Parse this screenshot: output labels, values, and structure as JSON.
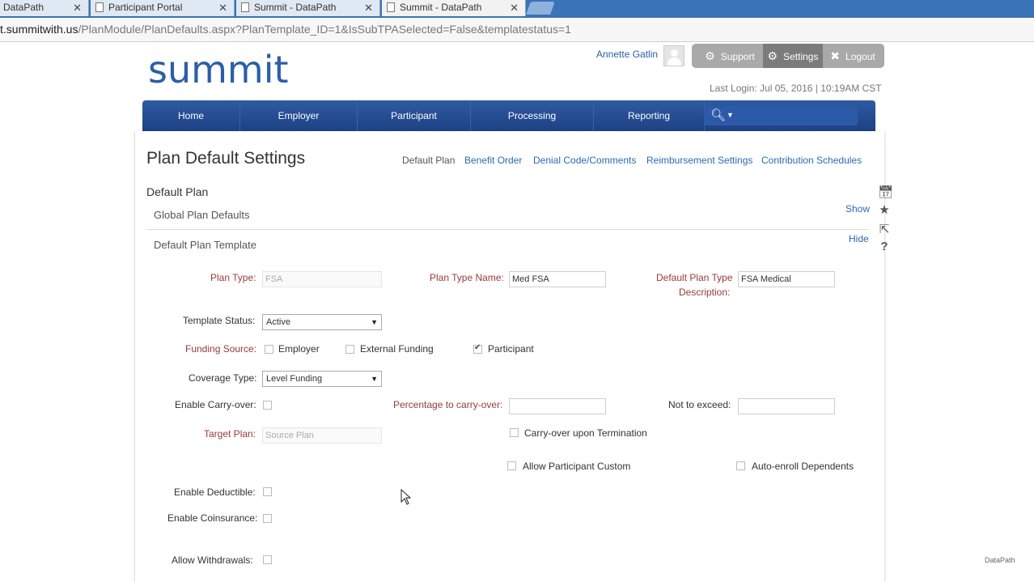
{
  "browser": {
    "tabs": [
      {
        "title": "DataPath"
      },
      {
        "title": "Participant Portal"
      },
      {
        "title": "Summit - DataPath"
      },
      {
        "title": "Summit - DataPath"
      }
    ],
    "close_glyph": "✕",
    "url_host": "t.summitwith.us",
    "url_path": "/PlanModule/PlanDefaults.aspx?PlanTemplate_ID=1&IsSubTPASelected=False&templatestatus=1"
  },
  "header": {
    "logo": "summit",
    "user_name": "Annette Gatlin",
    "support_label": "Support",
    "settings_label": "Settings",
    "logout_label": "Logout",
    "last_login": "Last Login: Jul 05, 2016 | 10:19AM CST"
  },
  "nav": {
    "items": [
      {
        "label": "Home"
      },
      {
        "label": "Employer"
      },
      {
        "label": "Participant"
      },
      {
        "label": "Processing"
      },
      {
        "label": "Reporting"
      }
    ]
  },
  "page": {
    "title": "Plan Default Settings",
    "subnav": [
      {
        "label": "Default Plan"
      },
      {
        "label": "Benefit Order"
      },
      {
        "label": "Denial Code/Comments"
      },
      {
        "label": "Reimbursement Settings"
      },
      {
        "label": "Contribution Schedules"
      }
    ],
    "section_title": "Default Plan",
    "global_defaults": "Global Plan Defaults",
    "show_label": "Show",
    "template_title": "Default Plan Template",
    "hide_label": "Hide"
  },
  "form": {
    "plan_type_label": "Plan Type:",
    "plan_type_value": "FSA",
    "plan_type_name_label": "Plan Type Name:",
    "plan_type_name_value": "Med FSA",
    "default_desc_label_1": "Default Plan Type",
    "default_desc_label_2": "Description:",
    "default_desc_value": "FSA Medical",
    "template_status_label": "Template Status:",
    "template_status_value": "Active",
    "funding_source_label": "Funding Source:",
    "funding_employer": "Employer",
    "funding_external": "External Funding",
    "funding_participant": "Participant",
    "coverage_type_label": "Coverage Type:",
    "coverage_type_value": "Level Funding",
    "carryover_label": "Enable Carry-over:",
    "pct_carryover_label": "Percentage to carry-over:",
    "not_exceed_label": "Not to exceed:",
    "target_plan_label": "Target Plan:",
    "target_plan_value": "Source Plan",
    "carryover_termination": "Carry-over upon Termination",
    "allow_participant_custom": "Allow Participant Custom",
    "auto_enroll": "Auto-enroll Dependents",
    "deductible_label": "Enable Deductible:",
    "coinsurance_label": "Enable Coinsurance:",
    "withdrawals_label": "Allow Withdrawals:"
  },
  "watermark": "DataPath"
}
